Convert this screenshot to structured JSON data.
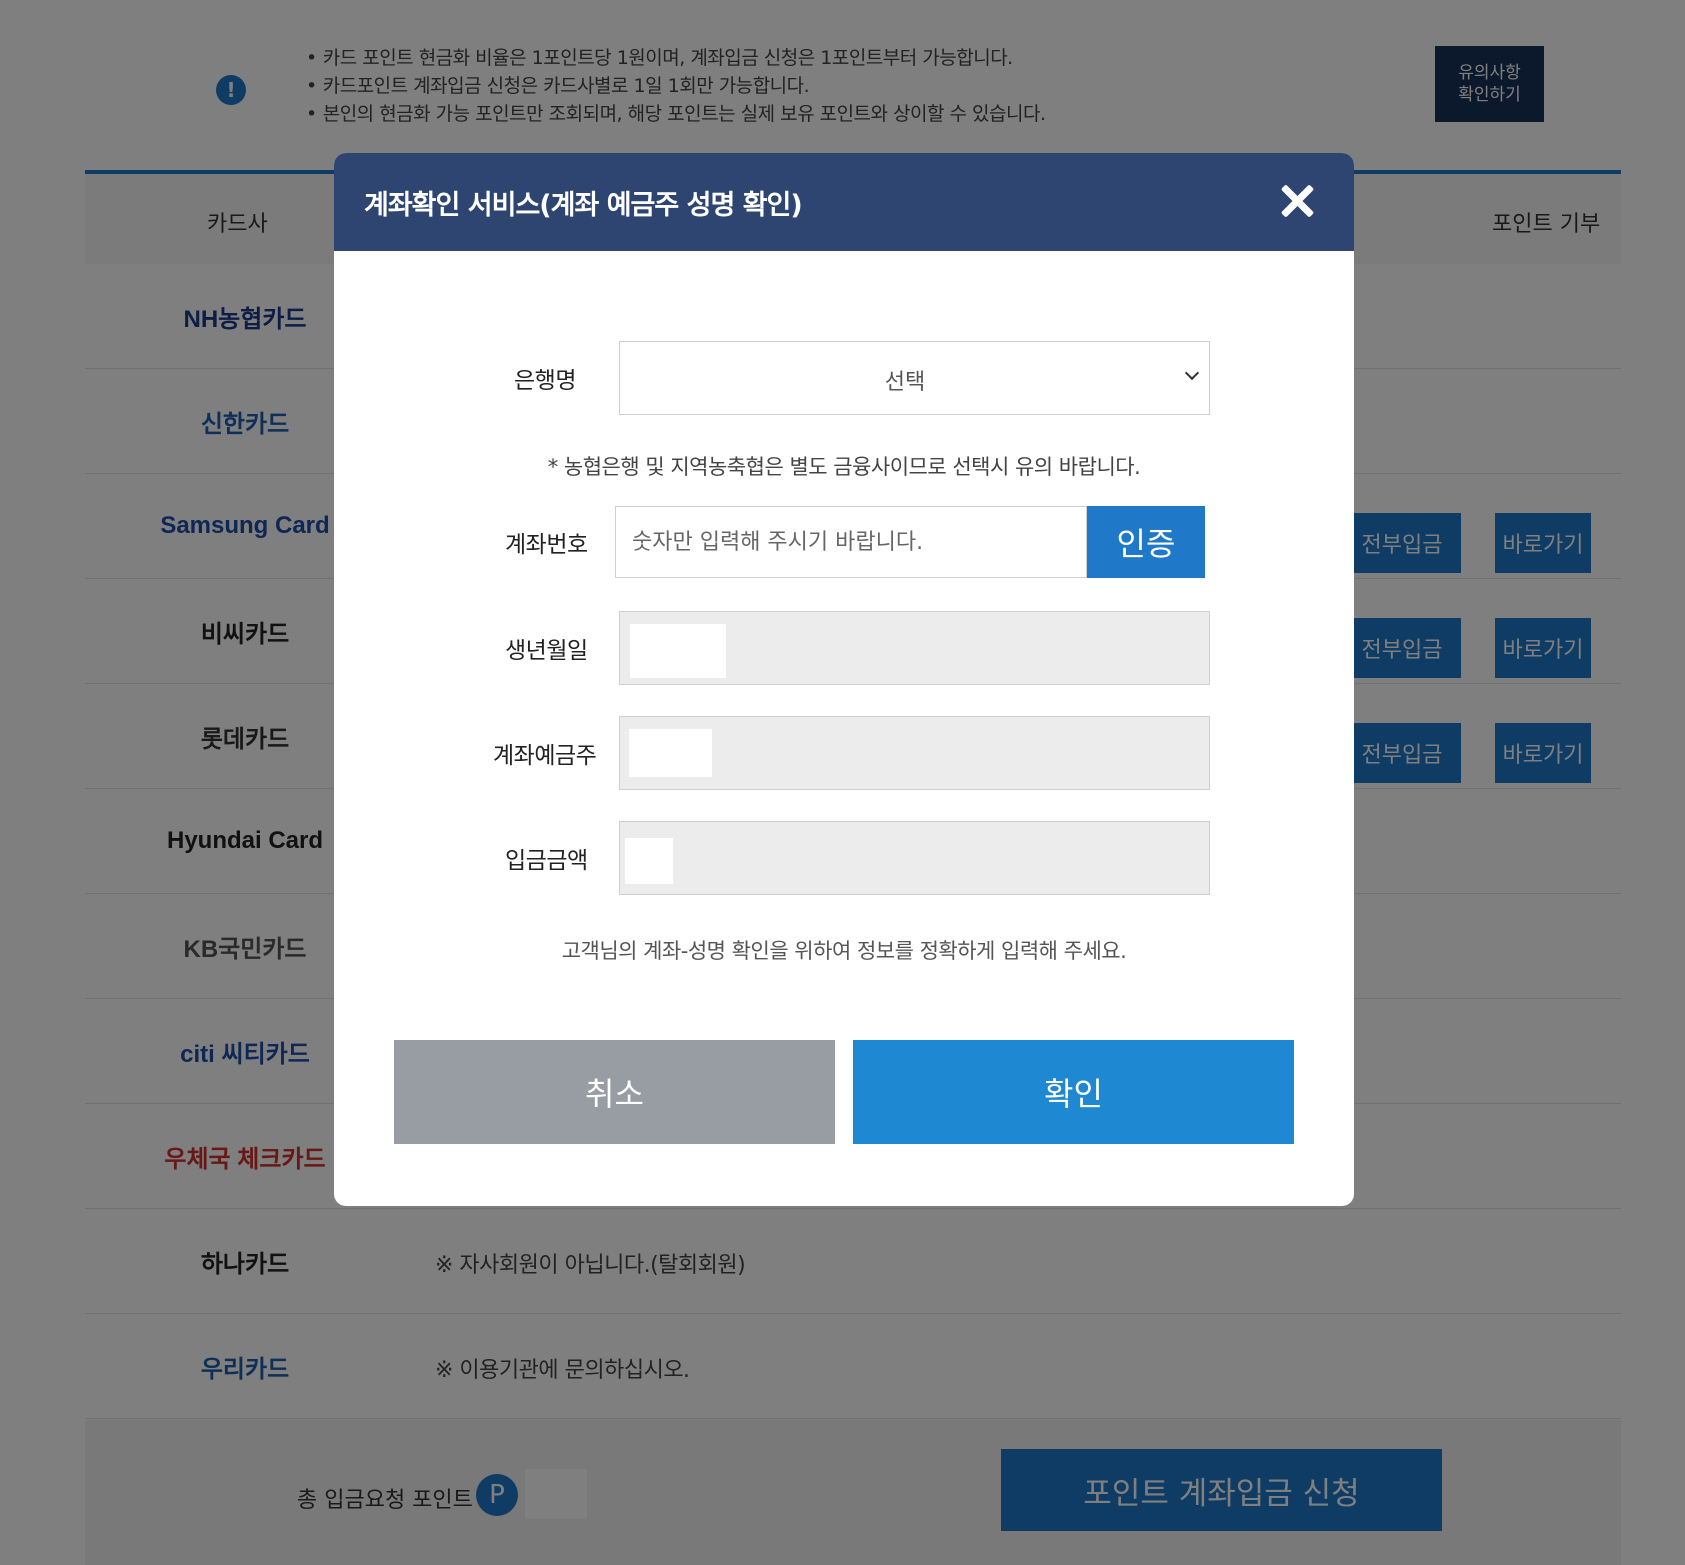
{
  "notice": {
    "items": [
      "카드 포인트 현금화 비율은 1포인트당 1원이며, 계좌입금 신청은 1포인트부터 가능합니다.",
      "카드포인트 계좌입금 신청은 카드사별로 1일 1회만 가능합니다.",
      "본인의 현금화 가능 포인트만 조회되며, 해당 포인트는 실제 보유 포인트와 상이할 수 있습니다."
    ],
    "button": "유의사항\n확인하기"
  },
  "table": {
    "headers": {
      "card_company": "카드사",
      "point_donation": "포인트 기부"
    },
    "rows": [
      {
        "logo": "NH농협카드",
        "color": "#1a3b8c",
        "actions": []
      },
      {
        "logo": "신한카드",
        "color": "#1f5fb0",
        "actions": []
      },
      {
        "logo": "Samsung Card",
        "color": "#1d4fa8",
        "actions": [
          "전부입금",
          "바로가기"
        ]
      },
      {
        "logo": "비씨카드",
        "color": "#222222",
        "actions": [
          "전부입금",
          "바로가기"
        ]
      },
      {
        "logo": "롯데카드",
        "color": "#333333",
        "actions": [
          "전부입금",
          "바로가기"
        ]
      },
      {
        "logo": "Hyundai Card",
        "color": "#222222",
        "actions": []
      },
      {
        "logo": "KB국민카드",
        "color": "#555555",
        "actions": []
      },
      {
        "logo": "citi 씨티카드",
        "color": "#1d4fa8",
        "actions": []
      },
      {
        "logo": "우체국 체크카드",
        "color": "#d0312d",
        "actions": []
      },
      {
        "logo": "하나카드",
        "color": "#222222",
        "note": "※ 자사회원이 아닙니다.(탈회회원)"
      },
      {
        "logo": "우리카드",
        "color": "#1f5fb0",
        "note": "※ 이용기관에 문의하십시오."
      }
    ]
  },
  "footer": {
    "total_label": "총 입금요청 포인트",
    "badge": "P",
    "apply_button": "포인트 계좌입금 신청"
  },
  "modal": {
    "title": "계좌확인 서비스(계좌 예금주 성명 확인)",
    "bank_label": "은행명",
    "bank_select_value": "선택",
    "bank_note": "* 농협은행 및 지역농축협은 별도 금융사이므로 선택시 유의 바랍니다.",
    "account_label": "계좌번호",
    "account_placeholder": "숫자만 입력해 주시기 바랍니다.",
    "auth_button": "인증",
    "birth_label": "생년월일",
    "holder_label": "계좌예금주",
    "amount_label": "입금금액",
    "helper_text": "고객님의 계좌-성명 확인을 위하여 정보를 정확하게 입력해 주세요.",
    "cancel_button": "취소",
    "confirm_button": "확인"
  }
}
